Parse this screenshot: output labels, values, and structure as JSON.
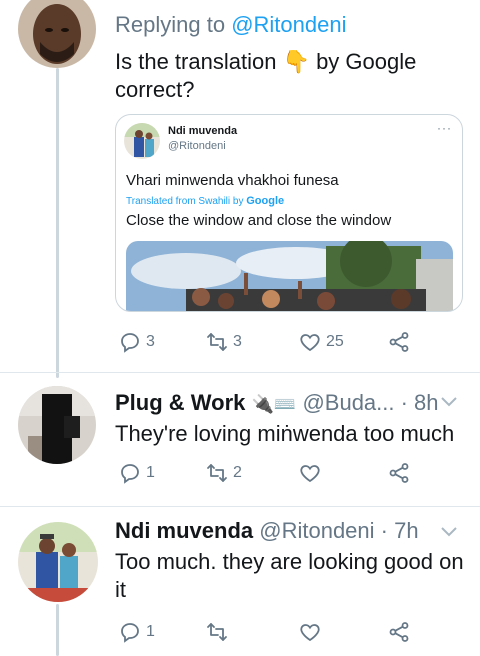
{
  "reply1": {
    "replying_prefix": "Replying to ",
    "replying_handle": "@Ritondeni",
    "text_line1_a": "Is the translation ",
    "text_line1_emoji": "👇",
    "text_line1_b": " by Google",
    "text_line2": "correct?",
    "quote": {
      "name": "Ndi muvenda",
      "handle": "@Ritondeni",
      "more": "···",
      "text": "Vhari minwenda vhakhoi funesa",
      "translated_prefix": "Translated from Swahili by ",
      "translated_brand": "Google",
      "translation": "Close the window and close the window"
    },
    "actions": {
      "replies": "3",
      "retweets": "3",
      "likes": "25"
    }
  },
  "reply2": {
    "name": "Plug & Work",
    "emojis": "🔌⌨️",
    "handle_time": " @Buda... · 8h",
    "text": "They're loving miṅwenda too much",
    "actions": {
      "replies": "1",
      "retweets": "2",
      "likes": ""
    }
  },
  "reply3": {
    "name": "Ndi muvenda",
    "handle_time": " @Ritondeni · 7h",
    "text_line1": "Too much. they are looking good on",
    "text_line2": "it",
    "actions": {
      "replies": "1",
      "retweets": "",
      "likes": ""
    }
  },
  "colors": {
    "accent": "#1da1f2",
    "muted": "#657786",
    "border": "#ccd6dd",
    "text": "#14171a"
  },
  "icons": [
    "reply-icon",
    "retweet-icon",
    "like-icon",
    "share-icon",
    "chevron-down-icon",
    "more-icon"
  ]
}
